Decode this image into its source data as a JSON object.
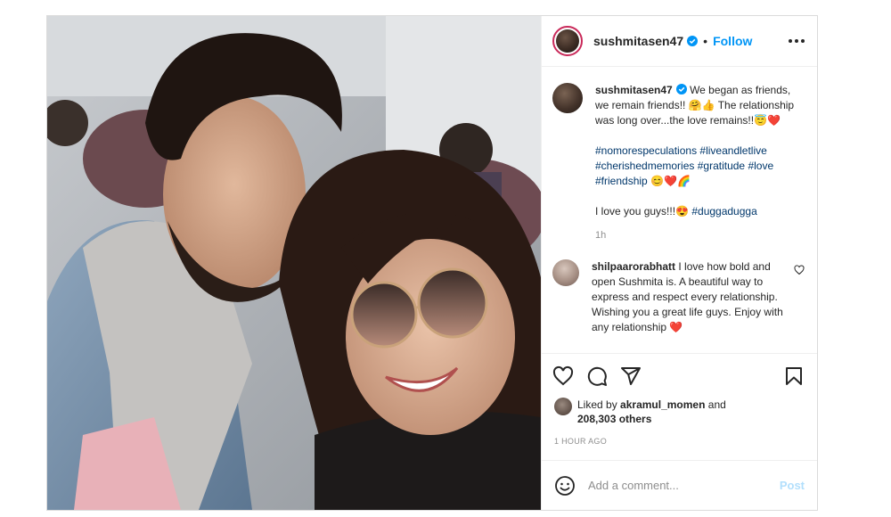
{
  "post": {
    "username": "sushmitasen47",
    "follow_label": "Follow",
    "separator": "•",
    "caption": {
      "username": "sushmitasen47",
      "line1": "We began as friends, we remain friends!! 🤗👍 The relationship was long over...the love remains!!😇❤️",
      "hashtags": [
        "#nomorespeculations",
        "#liveandletlive",
        "#cherishedmemories",
        "#gratitude",
        "#love",
        "#friendship"
      ],
      "hashtag_emojis": "😊❤️🌈",
      "line2": "I love you guys!!!😍",
      "line2_tag": "#duggadugga",
      "age": "1h"
    },
    "comments": [
      {
        "username": "shilpaarorabhatt",
        "text": "I love how bold and open Sushmita is. A beautiful way to express and respect every relationship. Wishing you a great life guys. Enjoy with any relationship ❤️"
      }
    ],
    "likes": {
      "prefix": "Liked by",
      "user": "akramul_momen",
      "joiner": "and",
      "others": "208,303 others"
    },
    "timestamp": "1 HOUR AGO",
    "comment_input": {
      "placeholder": "Add a comment..."
    },
    "post_label": "Post"
  },
  "colors": {
    "link_blue": "#0095f6",
    "hashtag": "#00376b",
    "muted": "#8e8e8e",
    "heart_red": "#ed4956",
    "post_disabled": "#b2dffc"
  },
  "icons": {
    "verified": "verified-badge-icon",
    "more": "more-options-icon",
    "like": "heart-icon",
    "comment": "comment-bubble-icon",
    "share": "paper-plane-icon",
    "save": "bookmark-icon",
    "emoji": "smiley-icon"
  }
}
